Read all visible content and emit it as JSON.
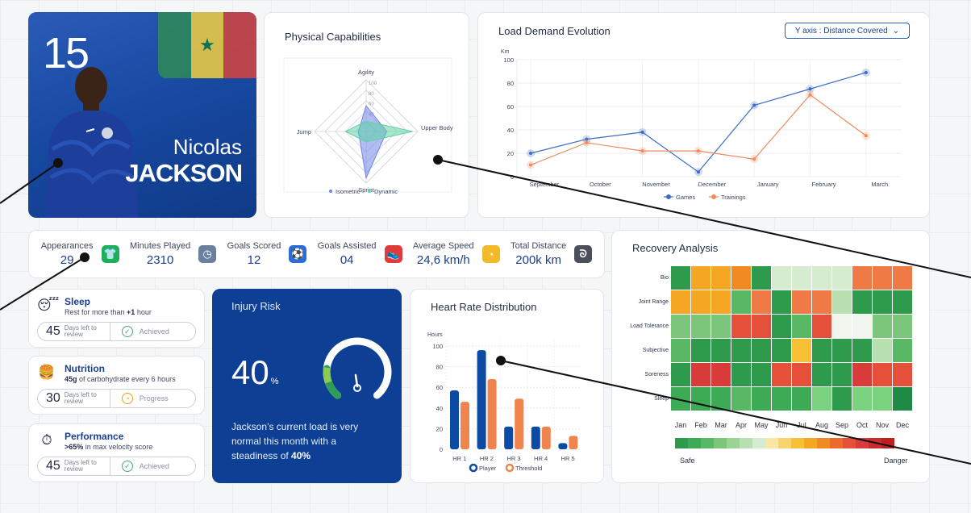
{
  "player": {
    "number": "15",
    "first_name": "Nicolas",
    "last_name": "JACKSON",
    "flag_colors": [
      "#2e8b57",
      "#f4d03f",
      "#d7443e"
    ]
  },
  "physical": {
    "title": "Physical Capabilities",
    "axes": [
      "Agility",
      "Upper Body",
      "Sprint",
      "Jump"
    ],
    "ticks": [
      "100",
      "80",
      "60",
      "40"
    ],
    "legend": [
      "Isometric",
      "Dynamic"
    ],
    "series": [
      {
        "name": "Isometric",
        "color": "#6f86e8",
        "values": [
          50,
          40,
          90,
          15
        ]
      },
      {
        "name": "Dynamic",
        "color": "#5fd3a4",
        "values": [
          20,
          90,
          20,
          40
        ]
      }
    ]
  },
  "load": {
    "title": "Load Demand Evolution",
    "select_label": "Y axis : Distance Covered",
    "unit": "Km",
    "chart_data": {
      "type": "line",
      "x": [
        "September",
        "October",
        "November",
        "December",
        "January",
        "February",
        "March"
      ],
      "ylim": [
        0,
        100
      ],
      "yticks": [
        "0",
        "20",
        "40",
        "60",
        "80",
        "100"
      ],
      "series": [
        {
          "name": "Games",
          "color": "#3a6cc4",
          "values": [
            20,
            32,
            38,
            4,
            61,
            75,
            89
          ]
        },
        {
          "name": "Trainings",
          "color": "#f08a5d",
          "values": [
            10,
            29,
            22,
            22,
            15,
            70,
            35
          ]
        }
      ]
    }
  },
  "stats": [
    {
      "label": "Appearances",
      "value": "29",
      "icon": "shirt-icon",
      "color": "#1fae5b",
      "glyph": "👕"
    },
    {
      "label": "Minutes Played",
      "value": "2310",
      "icon": "clock-icon",
      "color": "#6b7f9e",
      "glyph": "◷"
    },
    {
      "label": "Goals Scored",
      "value": "12",
      "icon": "ball-icon",
      "color": "#2a6dd8",
      "glyph": "⚽"
    },
    {
      "label": "Goals Assisted",
      "value": "04",
      "icon": "boot-icon",
      "color": "#e03b3b",
      "glyph": "👟"
    },
    {
      "label": "Average Speed",
      "value": "24,6 km/h",
      "icon": "speed-icon",
      "color": "#f2b928",
      "glyph": "◔"
    },
    {
      "label": "Total Distance",
      "value": "200k km",
      "icon": "route-icon",
      "color": "#4a4f59",
      "glyph": "ᘐ"
    }
  ],
  "small_cards": [
    {
      "title": "Sleep",
      "sub_pre": "Rest for more than ",
      "sub_bold": "+1",
      "sub_post": " hour",
      "emoji": "😴",
      "icon": "sleep-icon",
      "days": "45",
      "days_label": "Days left to review",
      "status": "Achieved",
      "status_glyph": "✓",
      "top": 358
    },
    {
      "title": "Nutrition",
      "sub_pre": "",
      "sub_bold": "45g",
      "sub_post": " of carbohydrate every 6 hours",
      "emoji": "🍔",
      "icon": "burger-icon",
      "days": "30",
      "days_label": "Days left to review",
      "status": "Progress",
      "status_glyph": "◔",
      "top": 441
    },
    {
      "title": "Performance",
      "sub_pre": "",
      "sub_bold": ">65%",
      "sub_post": " in max velocity score",
      "emoji": "⏱",
      "icon": "gauge-icon",
      "days": "45",
      "days_label": "Days left to review",
      "status": "Achieved",
      "status_glyph": "✓",
      "top": 525
    }
  ],
  "injury": {
    "title": "Injury Risk",
    "value": "40",
    "unit": "%",
    "risk_fraction": 0.4,
    "desc_pre": "Jackson’s current load is very normal this month with a steadiness of ",
    "desc_bold": "40%"
  },
  "heart": {
    "title": "Heart Rate Distribution",
    "unit": "Hours",
    "chart_data": {
      "type": "bar",
      "categories": [
        "HR 1",
        "HR 2",
        "HR 3",
        "HR 4",
        "HR 5"
      ],
      "ylim": [
        0,
        100
      ],
      "yticks": [
        "0",
        "20",
        "40",
        "60",
        "80",
        "100"
      ],
      "series": [
        {
          "name": "Player",
          "color": "#0d4aa3",
          "values": [
            57,
            96,
            22,
            22,
            6
          ]
        },
        {
          "name": "Threshold",
          "color": "#f0844f",
          "values": [
            46,
            68,
            49,
            22,
            13
          ]
        }
      ]
    }
  },
  "recovery": {
    "title": "Recovery Analysis",
    "rows": [
      "Bio",
      "Joint Range",
      "Load Tolerance",
      "Subjective",
      "Soreness",
      "Sleep"
    ],
    "months": [
      "Jan",
      "Feb",
      "Mar",
      "Apr",
      "May",
      "Jun",
      "Jul",
      "Aug",
      "Sep",
      "Oct",
      "Nov",
      "Dec"
    ],
    "scale_safe": "Safe",
    "scale_danger": "Danger",
    "scale_colors": [
      "#2e9a4b",
      "#3daa55",
      "#58b863",
      "#7bc67a",
      "#9ad393",
      "#b8e0b0",
      "#d6ecd0",
      "#fbe6a2",
      "#f9d36b",
      "#f7c035",
      "#f5a623",
      "#f18a22",
      "#ec6a2c",
      "#e4503a",
      "#d93b3b",
      "#cc2b2b",
      "#c11f1f"
    ],
    "cells": [
      [
        "#2e9a4b",
        "#f5a623",
        "#f5a623",
        "#f18a22",
        "#2e9a4b",
        "#d6ecd0",
        "#d6ecd0",
        "#d6ecd0",
        "#d6ecd0",
        "#f07a45",
        "#f07a45",
        "#f07a45"
      ],
      [
        "#f5a623",
        "#f5a623",
        "#f5a623",
        "#58b863",
        "#f07a45",
        "#2e9a4b",
        "#f07a45",
        "#f07a45",
        "#b8e0b0",
        "#2e9a4b",
        "#2e9a4b",
        "#2e9a4b"
      ],
      [
        "#7bc67a",
        "#7bc67a",
        "#7bc67a",
        "#e4503a",
        "#e4503a",
        "#2e9a4b",
        "#58b863",
        "#e4503a",
        "#f0f6ee",
        "#f0f6ee",
        "#7bc67a",
        "#7bc67a"
      ],
      [
        "#58b863",
        "#2e9a4b",
        "#2e9a4b",
        "#2e9a4b",
        "#2e9a4b",
        "#2e9a4b",
        "#f7c035",
        "#2e9a4b",
        "#2e9a4b",
        "#2e9a4b",
        "#b8e0b0",
        "#58b863"
      ],
      [
        "#2e9a4b",
        "#d93b3b",
        "#d93b3b",
        "#2e9a4b",
        "#2e9a4b",
        "#e4503a",
        "#e4503a",
        "#2e9a4b",
        "#2e9a4b",
        "#d93b3b",
        "#e4503a",
        "#e4503a"
      ],
      [
        "#3daa55",
        "#3daa55",
        "#3daa55",
        "#58b863",
        "#3daa55",
        "#3daa55",
        "#3daa55",
        "#7bd37f",
        "#2e9a4b",
        "#7bd37f",
        "#7bd37f",
        "#1f8a45"
      ]
    ]
  }
}
